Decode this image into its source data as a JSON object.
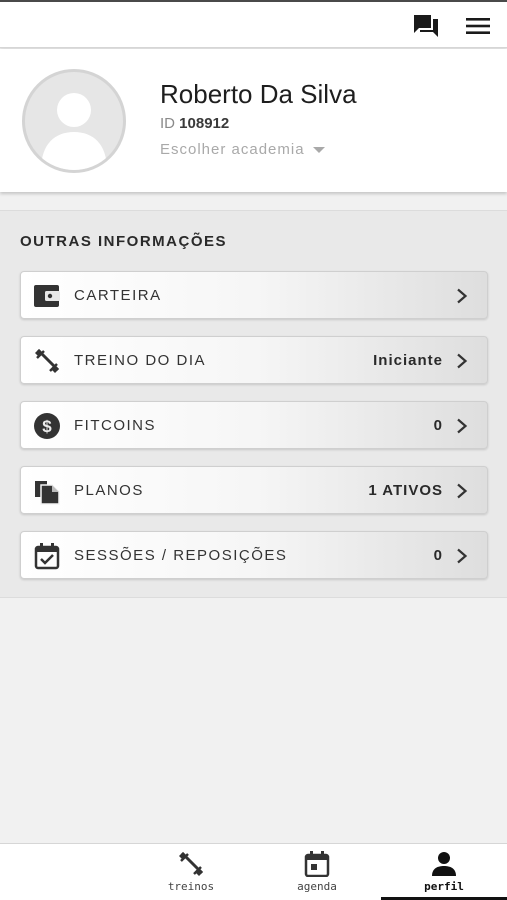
{
  "header": {
    "icons": [
      "chat-icon",
      "menu-icon"
    ]
  },
  "profile": {
    "name": "Roberto Da Silva",
    "id_prefix": "ID",
    "id_value": "108912",
    "gym_select": "Escolher academia"
  },
  "section": {
    "title": "OUTRAS INFORMAÇÕES",
    "items": [
      {
        "label": "CARTEIRA",
        "value": "",
        "icon": "wallet-icon"
      },
      {
        "label": "TREINO DO DIA",
        "value": "Iniciante",
        "icon": "dumbbell-icon"
      },
      {
        "label": "FITCOINS",
        "value": "0",
        "icon": "dollar-coin-icon"
      },
      {
        "label": "PLANOS",
        "value": "1 ATIVOS",
        "icon": "documents-icon"
      },
      {
        "label": "SESSÕES / REPOSIÇÕES",
        "value": "0",
        "icon": "calendar-check-icon"
      }
    ]
  },
  "bottom_nav": {
    "items": [
      {
        "label": "treinos",
        "icon": "dumbbell-icon",
        "active": false
      },
      {
        "label": "agenda",
        "icon": "calendar-icon",
        "active": false
      },
      {
        "label": "perfil",
        "icon": "person-icon",
        "active": true
      }
    ]
  },
  "colors": {
    "accent": "#111111",
    "background": "#f1f1f1"
  }
}
